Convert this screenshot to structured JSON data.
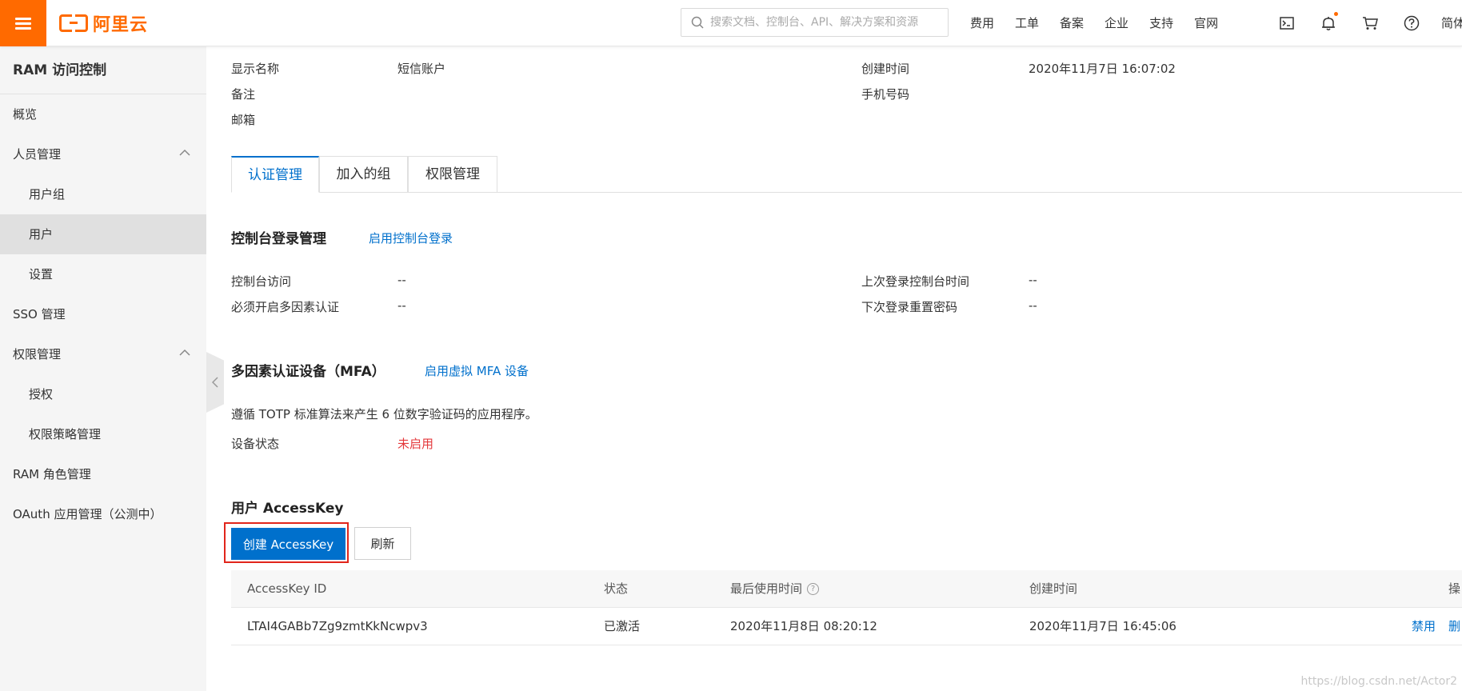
{
  "topbar": {
    "logo_text": "阿里云",
    "search_placeholder": "搜索文档、控制台、API、解决方案和资源",
    "nav": [
      "费用",
      "工单",
      "备案",
      "企业",
      "支持",
      "官网"
    ],
    "icons": [
      "terminal-icon",
      "bell-icon",
      "cart-icon",
      "help-icon"
    ],
    "lang": "简体",
    "accent_color": "#ff6a00"
  },
  "sidebar": {
    "title": "RAM 访问控制",
    "items": [
      {
        "label": "概览",
        "level": 1
      },
      {
        "label": "人员管理",
        "level": 1,
        "expanded": true
      },
      {
        "label": "用户组",
        "level": 2
      },
      {
        "label": "用户",
        "level": 2,
        "active": true
      },
      {
        "label": "设置",
        "level": 2
      },
      {
        "label": "SSO 管理",
        "level": 1
      },
      {
        "label": "权限管理",
        "level": 1,
        "expanded": true
      },
      {
        "label": "授权",
        "level": 2
      },
      {
        "label": "权限策略管理",
        "level": 2
      },
      {
        "label": "RAM 角色管理",
        "level": 1
      },
      {
        "label": "OAuth 应用管理（公测中）",
        "level": 1
      }
    ]
  },
  "basic_info": {
    "display_name_label": "显示名称",
    "display_name_value": "短信账户",
    "remark_label": "备注",
    "email_label": "邮箱",
    "created_label": "创建时间",
    "created_value": "2020年11月7日 16:07:02",
    "phone_label": "手机号码"
  },
  "tabs": [
    {
      "label": "认证管理",
      "active": true
    },
    {
      "label": "加入的组",
      "active": false
    },
    {
      "label": "权限管理",
      "active": false
    }
  ],
  "console_login": {
    "title": "控制台登录管理",
    "action_link": "启用控制台登录",
    "access_label": "控制台访问",
    "access_value": "--",
    "mfa_required_label": "必须开启多因素认证",
    "mfa_required_value": "--",
    "last_login_label": "上次登录控制台时间",
    "last_login_value": "--",
    "reset_pwd_label": "下次登录重置密码",
    "reset_pwd_value": "--"
  },
  "mfa": {
    "title": "多因素认证设备（MFA）",
    "action_link": "启用虚拟 MFA 设备",
    "description": "遵循 TOTP 标准算法来产生 6 位数字验证码的应用程序。",
    "status_label": "设备状态",
    "status_value": "未启用",
    "status_color": "#e4393c"
  },
  "accesskey": {
    "title": "用户 AccessKey",
    "create_button": "创建 AccessKey",
    "refresh_button": "刷新",
    "columns": [
      "AccessKey ID",
      "状态",
      "最后使用时间",
      "创建时间",
      "操"
    ],
    "rows": [
      {
        "id": "LTAI4GABb7Zg9zmtKkNcwpv3",
        "status": "已激活",
        "last_used": "2020年11月8日 08:20:12",
        "created": "2020年11月7日 16:45:06",
        "action_disable": "禁用",
        "action_delete": "删"
      }
    ]
  },
  "watermark": "https://blog.csdn.net/Actor2"
}
